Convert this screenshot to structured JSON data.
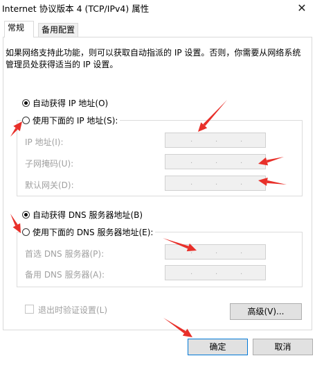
{
  "window": {
    "title": "Internet 协议版本 4 (TCP/IPv4) 属性",
    "close_glyph": "✕"
  },
  "tabs": [
    "常规",
    "备用配置"
  ],
  "description": "如果网络支持此功能，则可以获取自动指派的 IP 设置。否则，你需要从网络系统管理员处获得适当的 IP 设置。",
  "ip": {
    "auto_label": "自动获得 IP 地址(O)",
    "manual_label": "使用下面的 IP 地址(S):",
    "selected": "auto",
    "fields": [
      "IP 地址(I):",
      "子网掩码(U):",
      "默认网关(D):"
    ]
  },
  "dns": {
    "auto_label": "自动获得 DNS 服务器地址(B)",
    "manual_label": "使用下面的 DNS 服务器地址(E):",
    "selected": "auto",
    "fields": [
      "首选 DNS 服务器(P):",
      "备用 DNS 服务器(A):"
    ]
  },
  "validate_label": "退出时验证设置(L)",
  "buttons": {
    "advanced": "高级(V)...",
    "ok": "确定",
    "cancel": "取消"
  },
  "colors": {
    "arrow": "#e8302a",
    "focus_border": "#0078d7"
  },
  "ip_separator": "."
}
